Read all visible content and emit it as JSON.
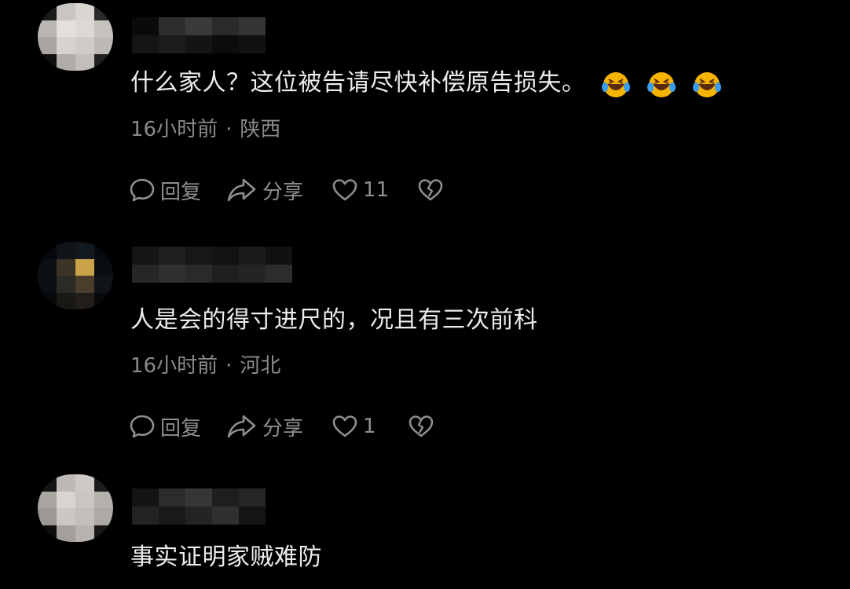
{
  "comments": [
    {
      "text": "什么家人？这位被告请尽快补偿原告损失。",
      "emojis": [
        "laughing-tears-emoji",
        "laughing-tears-emoji",
        "laughing-tears-emoji"
      ],
      "time": "16小时前",
      "separator": "·",
      "location": "陕西",
      "reply_label": "回复",
      "share_label": "分享",
      "likes": "11"
    },
    {
      "text": "人是会的得寸进尺的，况且有三次前科",
      "time": "16小时前",
      "separator": "·",
      "location": "河北",
      "reply_label": "回复",
      "share_label": "分享",
      "likes": "1"
    },
    {
      "text": "事实证明家贼难防"
    }
  ],
  "colors": {
    "background": "#000000",
    "text": "#ececec",
    "meta": "#8a8a8a",
    "action": "#8e8e8e",
    "emoji_face": "#f5b400",
    "emoji_tear": "#3b9cf0"
  }
}
